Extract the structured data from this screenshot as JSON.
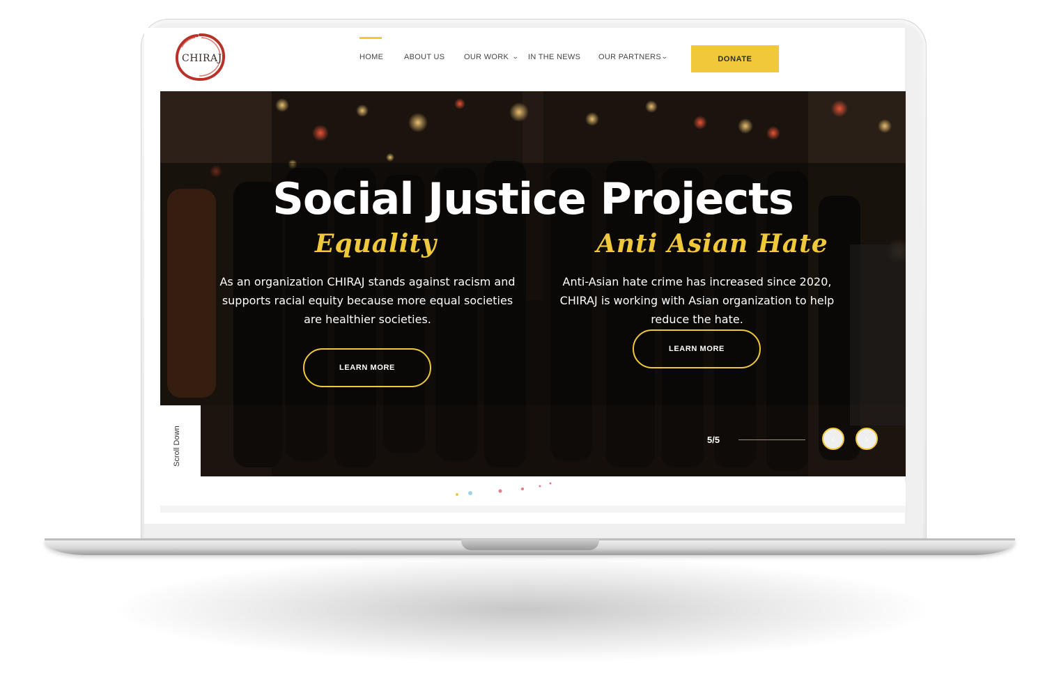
{
  "brand": {
    "logo_text": "CHIRAJ",
    "accent": "#f0c93a",
    "logo_ring": "#b8322a"
  },
  "nav": {
    "items": [
      {
        "label": "HOME",
        "active": true
      },
      {
        "label": "ABOUT US"
      },
      {
        "label": "OUR WORK",
        "dropdown": true
      },
      {
        "label": "IN THE NEWS"
      },
      {
        "label": "OUR PARTNERS",
        "dropdown": true
      }
    ],
    "donate_label": "DONATE"
  },
  "hero": {
    "title": "Social Justice Projects",
    "columns": [
      {
        "heading": "Equality",
        "text": "As an organization CHIRAJ stands against racism and supports racial equity because more equal societies are healthier societies.",
        "button": "LEARN MORE"
      },
      {
        "heading": "Anti Asian Hate",
        "text": "Anti-Asian hate crime has increased since 2020, CHIRAJ is working with Asian organization to help reduce the hate.",
        "button": "LEARN MORE"
      }
    ],
    "slide_counter": "5/5",
    "scroll_label": "Scroll Down",
    "prev_icon": "chevron-left-icon",
    "next_icon": "chevron-right-icon"
  }
}
